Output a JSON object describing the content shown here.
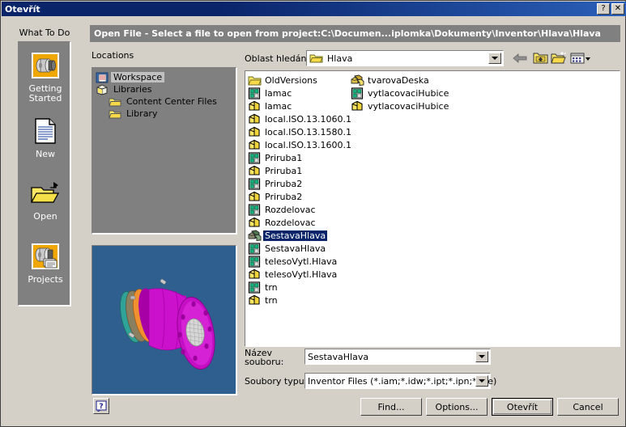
{
  "window": {
    "title": "Otevřít",
    "help_button": "?",
    "close_button": "✕"
  },
  "header": {
    "caption": "Open File - Select a file to open from project:C:\\Documen...iplomka\\Dokumenty\\Inventor\\Hlava\\Hlava"
  },
  "what_to_do": {
    "label": "What To Do",
    "items": [
      {
        "label": "Getting\nStarted",
        "line1": "Getting",
        "line2": "Started",
        "icon": "inventor-assembly-icon"
      },
      {
        "label": "New",
        "line1": "New",
        "line2": "",
        "icon": "new-document-icon"
      },
      {
        "label": "Open",
        "line1": "Open",
        "line2": "",
        "icon": "open-folder-icon"
      },
      {
        "label": "Projects",
        "line1": "Projects",
        "line2": "",
        "icon": "projects-icon"
      }
    ]
  },
  "locations": {
    "label": "Locations",
    "items": [
      {
        "label": "Workspace",
        "icon": "workspace-icon",
        "indent": 0,
        "selected": true
      },
      {
        "label": "Libraries",
        "icon": "libraries-icon",
        "indent": 0,
        "selected": false
      },
      {
        "label": "Content Center Files",
        "icon": "folder-icon",
        "indent": 1,
        "selected": false
      },
      {
        "label": "Library",
        "icon": "folder-icon",
        "indent": 1,
        "selected": false
      }
    ]
  },
  "look_in": {
    "label": "Oblast hledání:",
    "value": "Hlava",
    "icon": "folder-icon",
    "toolbar": [
      {
        "name": "back-button",
        "icon": "back-arrow-icon"
      },
      {
        "name": "up-one-level-button",
        "icon": "up-folder-icon"
      },
      {
        "name": "new-folder-button",
        "icon": "new-folder-icon"
      },
      {
        "name": "views-button",
        "icon": "views-list-icon"
      }
    ]
  },
  "file_list": {
    "column1": [
      {
        "name": "OldVersions",
        "type": "folder"
      },
      {
        "name": "lamac",
        "type": "drawing"
      },
      {
        "name": "lamac",
        "type": "part"
      },
      {
        "name": "local.ISO.13.1060.1",
        "type": "part"
      },
      {
        "name": "local.ISO.13.1580.1",
        "type": "part"
      },
      {
        "name": "local.ISO.13.1600.1",
        "type": "part"
      },
      {
        "name": "Priruba1",
        "type": "drawing"
      },
      {
        "name": "Priruba1",
        "type": "part"
      },
      {
        "name": "Priruba2",
        "type": "drawing"
      },
      {
        "name": "Priruba2",
        "type": "part"
      },
      {
        "name": "Rozdelovac",
        "type": "drawing"
      },
      {
        "name": "Rozdelovac",
        "type": "part"
      },
      {
        "name": "SestavaHlava",
        "type": "assembly",
        "selected": true
      },
      {
        "name": "SestavaHlava",
        "type": "drawing"
      },
      {
        "name": "telesoVytl.Hlava",
        "type": "drawing"
      },
      {
        "name": "telesoVytl.Hlava",
        "type": "part"
      },
      {
        "name": "trn",
        "type": "drawing"
      },
      {
        "name": "trn",
        "type": "part"
      }
    ],
    "column2": [
      {
        "name": "tvarovaDeska",
        "type": "assembly"
      },
      {
        "name": "vytlacovaciHubice",
        "type": "drawing"
      },
      {
        "name": "vytlacovaciHubice",
        "type": "part"
      }
    ]
  },
  "fields": {
    "filename_label": "Název souboru:",
    "filename_value": "SestavaHlava",
    "filetype_label": "Soubory typu:",
    "filetype_value": "Inventor Files (*.iam;*.idw;*.ipt;*.ipn;*.ide)"
  },
  "buttons": {
    "find": "Find...",
    "options": "Options...",
    "open": "Otevřít",
    "cancel": "Cancel",
    "help": "?"
  },
  "preview": {
    "name": "3d-model-preview",
    "background_color": "#2e5f8f",
    "model_color": "#cc11cc"
  },
  "colors": {
    "dialog_face": "#d4d0c8",
    "title_active": "#0a246a",
    "panel_gray": "#808080",
    "selection_blue": "#0a246a",
    "preview_bg": "#2e5f8f"
  }
}
